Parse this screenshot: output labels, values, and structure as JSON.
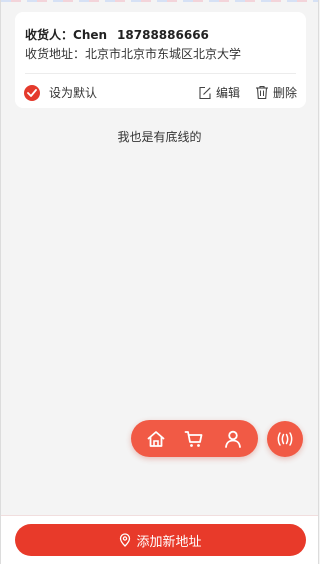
{
  "address_card": {
    "recipient_label": "收货人：",
    "recipient_name": "Chen",
    "phone": "18788886666",
    "address_label": "收货地址：",
    "address": "北京市北京市东城区北京大学",
    "set_default_label": "设为默认",
    "is_default": true,
    "edit_label": "编辑",
    "delete_label": "删除"
  },
  "list_end_text": "我也是有底线的",
  "footer": {
    "add_address_label": "添加新地址"
  },
  "colors": {
    "accent": "#e83a2a",
    "fab": "#f15a45",
    "background": "#f4f4f4"
  },
  "icons": {
    "floating_nav": [
      "home-icon",
      "cart-icon",
      "user-icon"
    ],
    "floating_toggle": "waves-icon",
    "default_check": "check-circle-icon",
    "edit": "edit-icon",
    "delete": "trash-icon",
    "add": "location-pin-icon"
  }
}
